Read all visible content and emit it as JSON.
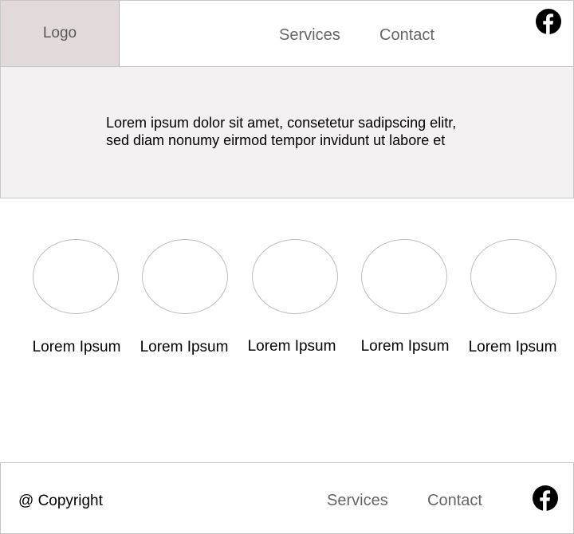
{
  "header": {
    "logo": "Logo",
    "nav": [
      {
        "label": "Services"
      },
      {
        "label": "Contact"
      }
    ],
    "social_icon": "facebook-icon"
  },
  "hero": {
    "line1": "Lorem ipsum dolor sit amet, consetetur sadipscing elitr,",
    "line2": "sed diam nonumy eirmod tempor invidunt ut labore et"
  },
  "features": [
    {
      "label": "Lorem Ipsum"
    },
    {
      "label": "Lorem Ipsum"
    },
    {
      "label": "Lorem Ipsum"
    },
    {
      "label": "Lorem Ipsum"
    },
    {
      "label": "Lorem Ipsum"
    }
  ],
  "footer": {
    "copyright": "@ Copyright",
    "nav": [
      {
        "label": "Services"
      },
      {
        "label": "Contact"
      }
    ],
    "social_icon": "facebook-icon"
  },
  "colors": {
    "logo_bg": "#e2d9da",
    "hero_bg": "#f3f1f2",
    "nav_text": "#666666",
    "border": "#c8c8c8"
  }
}
